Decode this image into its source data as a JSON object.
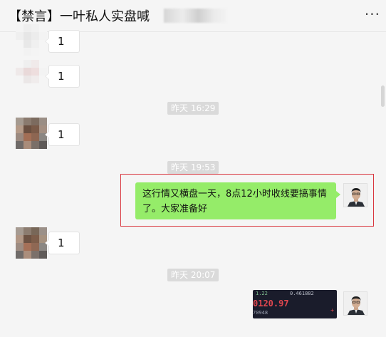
{
  "header": {
    "title": "【禁言】一叶私人实盘喊",
    "more_label": "···"
  },
  "messages": [
    {
      "side": "left",
      "text": "1"
    },
    {
      "side": "left",
      "text": "1"
    },
    {
      "type": "time",
      "text": "昨天 16:29"
    },
    {
      "side": "left",
      "text": "1"
    },
    {
      "type": "time",
      "text": "昨天 19:53"
    },
    {
      "side": "right",
      "text": "这行情又横盘一天，8点12小时收线要搞事情了。大家准备好",
      "highlighted": true,
      "accent": "#95ec69",
      "highlight_color": "#d9363e"
    },
    {
      "side": "left",
      "text": "1"
    },
    {
      "type": "time",
      "text": "昨天 20:07"
    },
    {
      "side": "right",
      "type": "image",
      "top_value": "1.22",
      "top_value2": "0.461882",
      "price": "0120.97",
      "sub": "70948",
      "plus": "+"
    }
  ]
}
